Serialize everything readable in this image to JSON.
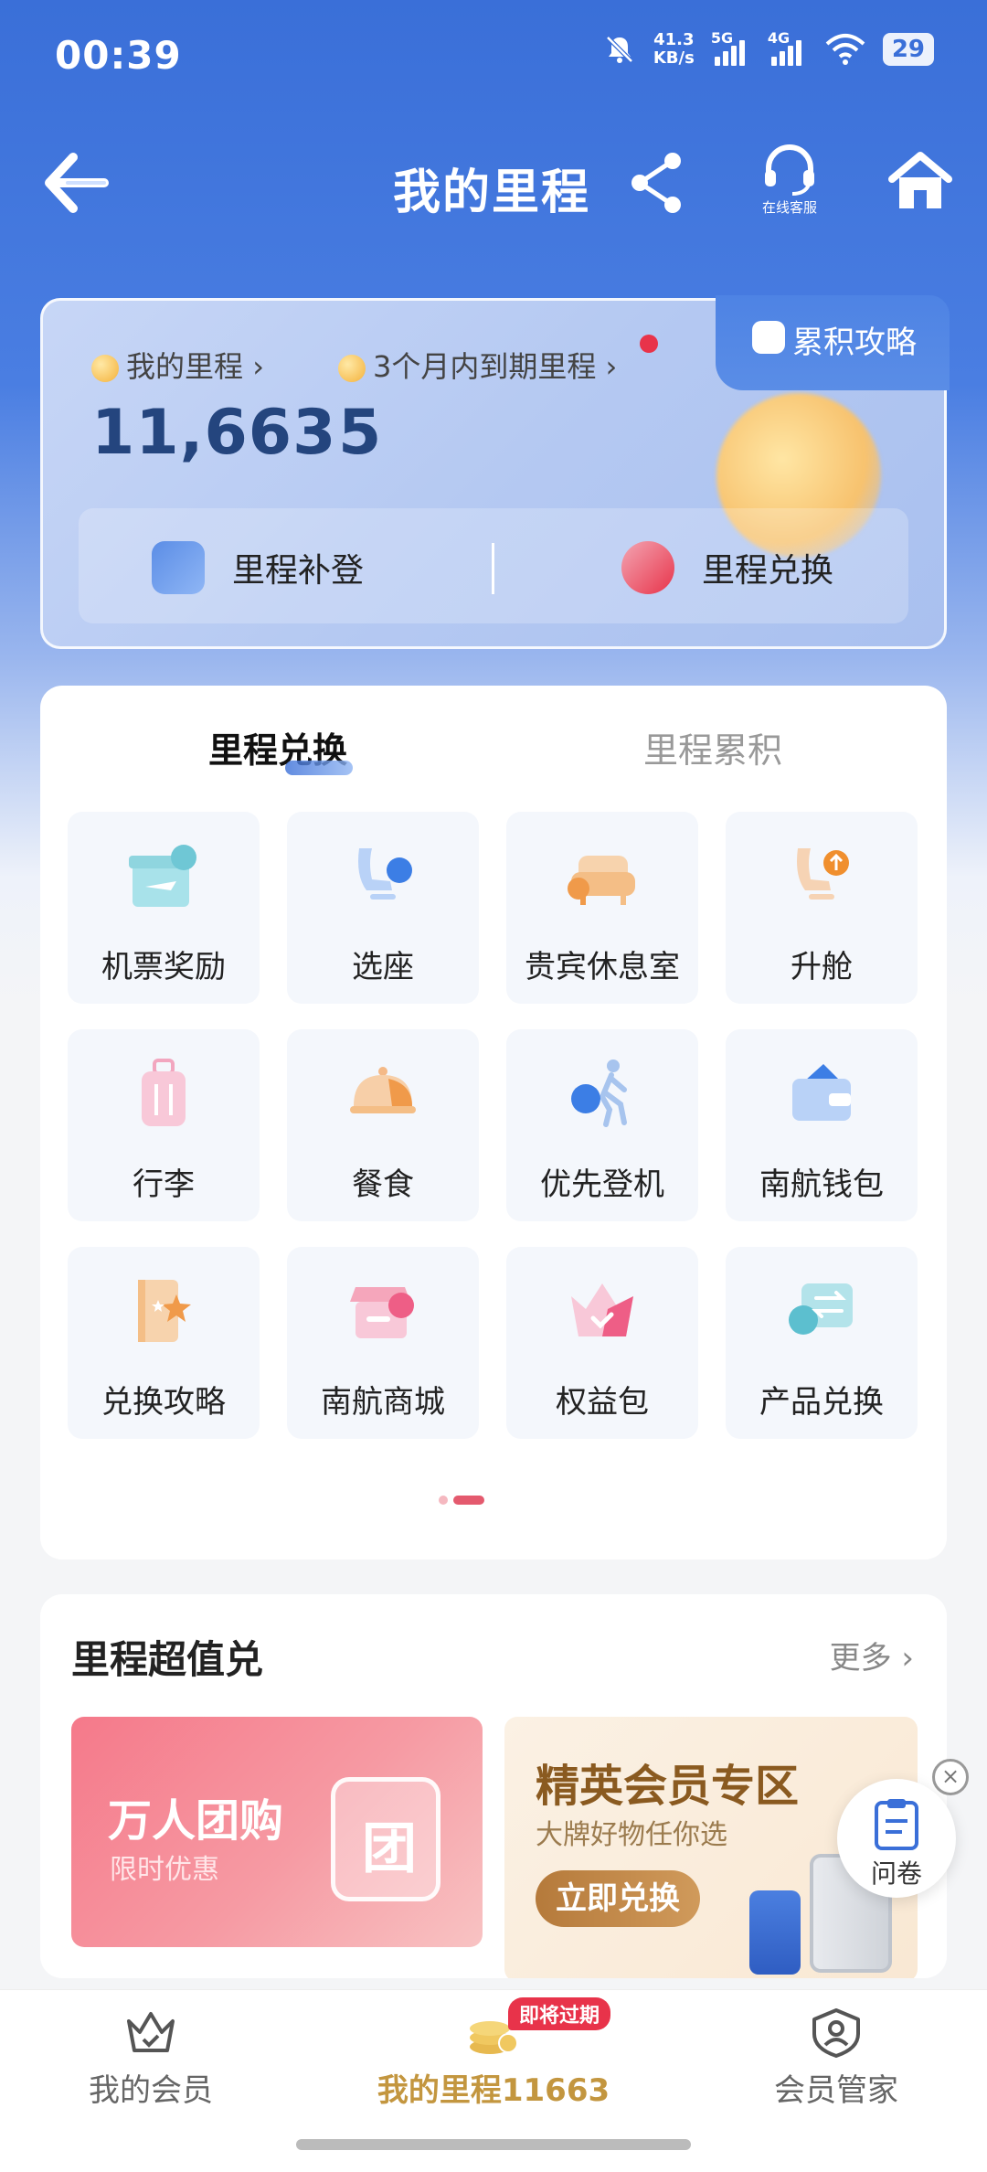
{
  "status_bar": {
    "time": "00:39",
    "net_speed_value": "41.3",
    "net_speed_unit": "KB/s",
    "sim1": "5G",
    "sim2": "4G",
    "battery": "29"
  },
  "nav": {
    "title": "我的里程",
    "service_caption": "在线客服"
  },
  "miles_card": {
    "strategy_label": "累积攻略",
    "my_miles_label": "我的里程",
    "expire_label": "3个月内到期里程",
    "my_miles_value": "11,663",
    "expire_value": "5",
    "action_1": "里程补登",
    "action_2": "里程兑换"
  },
  "panel": {
    "tab_active": "里程兑换",
    "tab_inactive": "里程累积",
    "items": [
      {
        "label": "机票奖励",
        "icon": "ticket-gift-icon"
      },
      {
        "label": "选座",
        "icon": "seat-icon"
      },
      {
        "label": "贵宾休息室",
        "icon": "sofa-icon"
      },
      {
        "label": "升舱",
        "icon": "upgrade-seat-icon"
      },
      {
        "label": "行李",
        "icon": "luggage-icon"
      },
      {
        "label": "餐食",
        "icon": "meal-icon"
      },
      {
        "label": "优先登机",
        "icon": "priority-boarding-icon"
      },
      {
        "label": "南航钱包",
        "icon": "wallet-icon"
      },
      {
        "label": "兑换攻略",
        "icon": "guide-book-icon"
      },
      {
        "label": "南航商城",
        "icon": "shop-icon"
      },
      {
        "label": "权益包",
        "icon": "crown-icon"
      },
      {
        "label": "产品兑换",
        "icon": "exchange-icon"
      }
    ]
  },
  "deals": {
    "title": "里程超值兑",
    "more": "更多",
    "promo_a_title": "万人团购",
    "promo_a_sub": "限时优惠",
    "promo_a_bag_text": "团",
    "promo_b_title": "精英会员专区",
    "promo_b_sub": "大牌好物任你选",
    "promo_b_button": "立即兑换"
  },
  "survey": {
    "caption": "问卷"
  },
  "bottom_nav": {
    "item_1": "我的会员",
    "item_2": "我的里程11663",
    "item_2_badge": "即将过期",
    "item_3": "会员管家"
  },
  "colors": {
    "brand_blue": "#3a6fd8",
    "gold": "#c3963f",
    "badge_red": "#e8334a"
  }
}
